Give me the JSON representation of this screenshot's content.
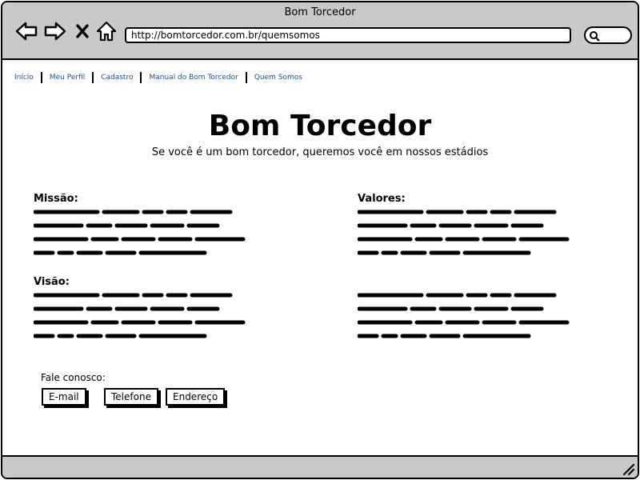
{
  "browser": {
    "title": "Bom Torcedor",
    "url": "http://bomtorcedor.com.br/quemsomos",
    "icons": [
      "back-icon",
      "forward-icon",
      "close-icon",
      "home-icon",
      "search-icon",
      "resize-grip-icon"
    ]
  },
  "menu": {
    "items": [
      "Início",
      "Meu Perfil",
      "Cadastro",
      "Manual do Bom Torcedor",
      "Quem Somos"
    ]
  },
  "page": {
    "title": "Bom Torcedor",
    "subtitle": "Se você é um bom torcedor, queremos você em nossos estádios"
  },
  "sections": {
    "missao": "Missão:",
    "valores": "Valores:",
    "visao": "Visão:"
  },
  "contact": {
    "label": "Fale conosco:",
    "email": "E-mail",
    "telefone": "Telefone",
    "endereco": "Endereço"
  },
  "colors": {
    "chrome": "#c9c9c9",
    "link": "#1f4f8f"
  }
}
